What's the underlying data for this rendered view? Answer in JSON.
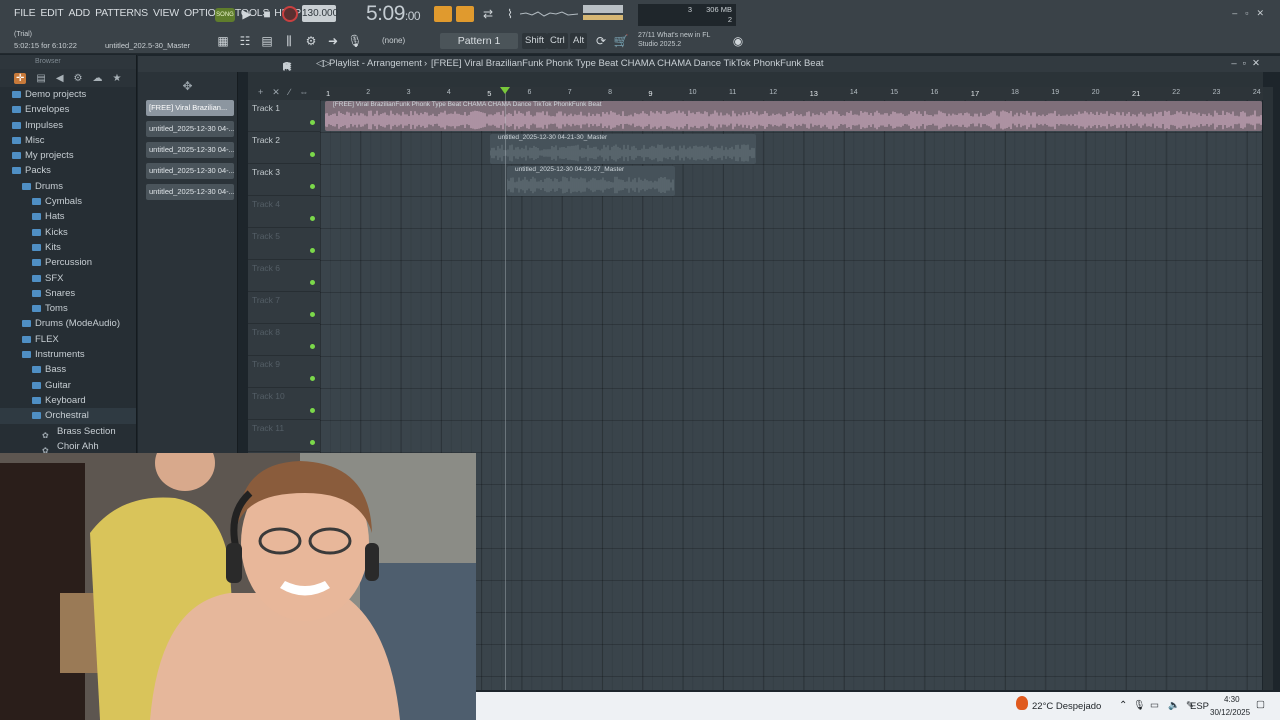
{
  "menu": [
    "FILE",
    "EDIT",
    "ADD",
    "PATTERNS",
    "VIEW",
    "OPTIONS",
    "TOOLS",
    "HELP"
  ],
  "transport": {
    "song_mode": "SONG",
    "tempo": "130.000",
    "time_main": "5:09",
    "time_sub": ":00"
  },
  "info": {
    "trial": "(Trial)",
    "trial_time": "5:02:15 for 6:10:22",
    "project": "untitled_202.5-30_Master"
  },
  "toolbar": {
    "none_label": "(none)",
    "pattern_label": "Pattern 1",
    "shift": "Shift",
    "ctrl": "Ctrl",
    "alt": "Alt",
    "news_line1": "27/11  What's new in FL",
    "news_line2": "Studio 2025.2",
    "cpu_line1": "3",
    "mem": "306 MB",
    "cpu_line2": "2"
  },
  "browser": {
    "title": "Browser",
    "items": [
      {
        "label": "Demo projects",
        "indent": 12
      },
      {
        "label": "Envelopes",
        "indent": 12
      },
      {
        "label": "Impulses",
        "indent": 12
      },
      {
        "label": "Misc",
        "indent": 12
      },
      {
        "label": "My projects",
        "indent": 12
      },
      {
        "label": "Packs",
        "indent": 12
      },
      {
        "label": "Drums",
        "indent": 22
      },
      {
        "label": "Cymbals",
        "indent": 32
      },
      {
        "label": "Hats",
        "indent": 32
      },
      {
        "label": "Kicks",
        "indent": 32
      },
      {
        "label": "Kits",
        "indent": 32
      },
      {
        "label": "Percussion",
        "indent": 32
      },
      {
        "label": "SFX",
        "indent": 32
      },
      {
        "label": "Snares",
        "indent": 32
      },
      {
        "label": "Toms",
        "indent": 32
      },
      {
        "label": "Drums (ModeAudio)",
        "indent": 22
      },
      {
        "label": "FLEX",
        "indent": 22
      },
      {
        "label": "Instruments",
        "indent": 22
      },
      {
        "label": "Bass",
        "indent": 32
      },
      {
        "label": "Guitar",
        "indent": 32
      },
      {
        "label": "Keyboard",
        "indent": 32
      },
      {
        "label": "Orchestral",
        "indent": 32
      },
      {
        "label": "Brass Section",
        "indent": 42
      },
      {
        "label": "Choir Ahh",
        "indent": 42
      }
    ]
  },
  "picker": [
    "[FREE] Viral Brazilian...",
    "untitled_2025-12-30 04-...",
    "untitled_2025-12-30 04-...",
    "untitled_2025-12-30 04-...",
    "untitled_2025-12-30 04-..."
  ],
  "playlist": {
    "title": "Playlist - Arrangement",
    "arrangement": "[FREE] Viral BrazilianFunk Phonk Type Beat  CHAMA CHAMA  Dance TikTok PhonkFunk Beat",
    "tracks": [
      "Track 1",
      "Track 2",
      "Track 3",
      "Track 4",
      "Track 5",
      "Track 6",
      "Track 7",
      "Track 8",
      "Track 9",
      "Track 10",
      "Track 11"
    ],
    "ruler": [
      "1",
      "2",
      "3",
      "4",
      "5",
      "6",
      "7",
      "8",
      "9",
      "10",
      "11",
      "12",
      "13",
      "14",
      "15",
      "16",
      "17",
      "18",
      "19",
      "20",
      "21",
      "22",
      "23",
      "24"
    ],
    "clips": [
      {
        "label": "[FREE] Viral BrazilianFunk Phonk Type Beat  CHAMA CHAMA  Dance TikTok PhonkFunk Beat",
        "color": "#b89aac"
      },
      {
        "label": "untitled_2025-12-30 04-21-30_Master",
        "color": "#5c6970"
      },
      {
        "label": "untitled_2025-12-30 04-29-27_Master",
        "color": "#5c6970"
      }
    ]
  },
  "taskbar": {
    "weather": "22°C  Despejado",
    "lang": "ESP",
    "clock": "4:30",
    "date": "30/12/2025"
  }
}
